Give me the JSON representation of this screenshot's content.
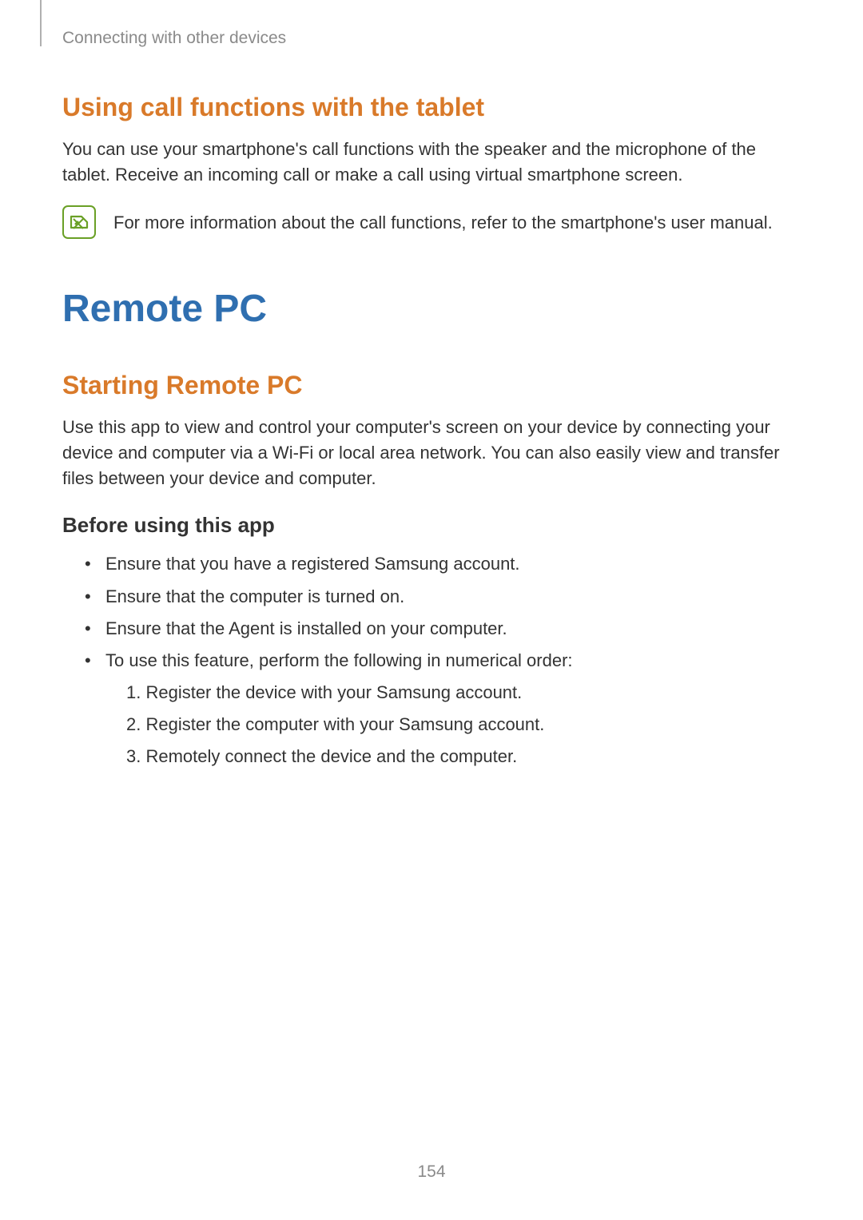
{
  "running_header": "Connecting with other devices",
  "section1": {
    "heading": "Using call functions with the tablet",
    "body": "You can use your smartphone's call functions with the speaker and the microphone of the tablet. Receive an incoming call or make a call using virtual smartphone screen.",
    "note": "For more information about the call functions, refer to the smartphone's user manual."
  },
  "section2": {
    "title": "Remote PC",
    "heading": "Starting Remote PC",
    "body": "Use this app to view and control your computer's screen on your device by connecting your device and computer via a Wi-Fi or local area network. You can also easily view and transfer files between your device and computer.",
    "sub_heading": "Before using this app",
    "bullets": [
      "Ensure that you have a registered Samsung account.",
      "Ensure that the computer is turned on.",
      "Ensure that the Agent is installed on your computer.",
      "To use this feature, perform the following in numerical order:"
    ],
    "steps": [
      "1. Register the device with your Samsung account.",
      "2. Register the computer with your Samsung account.",
      "3. Remotely connect the device and the computer."
    ]
  },
  "page_number": "154"
}
